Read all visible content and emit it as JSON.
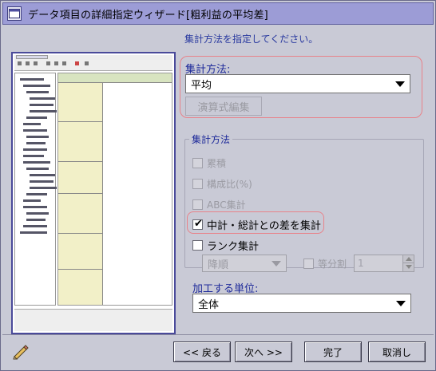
{
  "window": {
    "title": "データ項目の詳細指定ウィザード[粗利益の平均差]"
  },
  "instruction": "集計方法を指定してください。",
  "aggregation_method": {
    "label": "集計方法:",
    "selected": "平均",
    "formula_button": "演算式編集"
  },
  "method_group": {
    "title": "集計方法",
    "options": [
      {
        "label": "累積",
        "checked": false,
        "enabled": false
      },
      {
        "label": "構成比(%)",
        "checked": false,
        "enabled": false
      },
      {
        "label": "ABC集計",
        "checked": false,
        "enabled": false
      },
      {
        "label": "中計・総計との差を集計",
        "checked": true,
        "enabled": true
      },
      {
        "label": "ランク集計",
        "checked": false,
        "enabled": true
      }
    ],
    "rank_order": "降順",
    "equal_split": {
      "label": "等分割",
      "checked": false,
      "value": "1"
    }
  },
  "unit": {
    "label": "加工する単位:",
    "selected": "全体"
  },
  "buttons": {
    "back": "<< 戻る",
    "next": "次へ >>",
    "finish": "完了",
    "cancel": "取消し"
  },
  "icons": {
    "system_menu": "dialog-icon",
    "edit": "pencil-icon"
  },
  "colors": {
    "background": "#c9cad6",
    "title_bar": "#9c9cd6",
    "highlight": "#e8828a",
    "label_blue": "#1e2a9a"
  }
}
